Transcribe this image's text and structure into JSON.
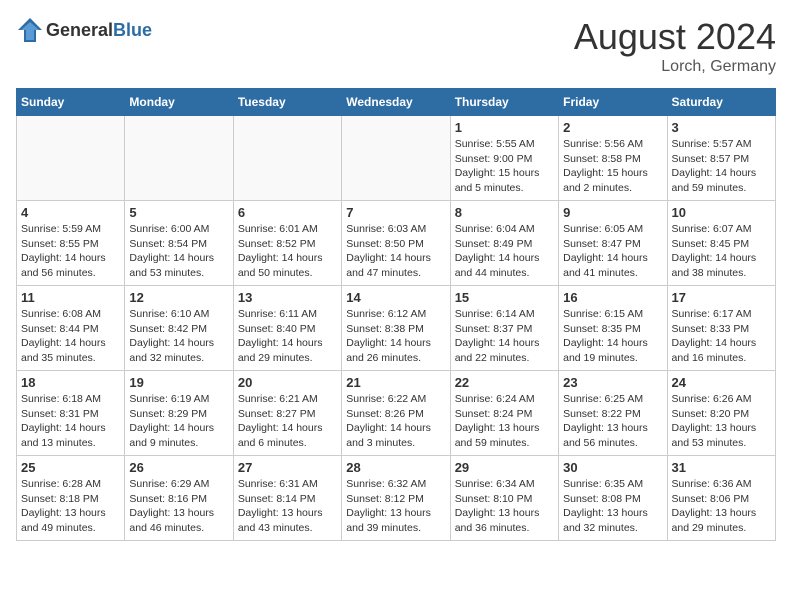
{
  "header": {
    "logo_general": "General",
    "logo_blue": "Blue",
    "month_title": "August 2024",
    "location": "Lorch, Germany"
  },
  "weekdays": [
    "Sunday",
    "Monday",
    "Tuesday",
    "Wednesday",
    "Thursday",
    "Friday",
    "Saturday"
  ],
  "weeks": [
    [
      {
        "day": "",
        "info": ""
      },
      {
        "day": "",
        "info": ""
      },
      {
        "day": "",
        "info": ""
      },
      {
        "day": "",
        "info": ""
      },
      {
        "day": "1",
        "info": "Sunrise: 5:55 AM\nSunset: 9:00 PM\nDaylight: 15 hours\nand 5 minutes."
      },
      {
        "day": "2",
        "info": "Sunrise: 5:56 AM\nSunset: 8:58 PM\nDaylight: 15 hours\nand 2 minutes."
      },
      {
        "day": "3",
        "info": "Sunrise: 5:57 AM\nSunset: 8:57 PM\nDaylight: 14 hours\nand 59 minutes."
      }
    ],
    [
      {
        "day": "4",
        "info": "Sunrise: 5:59 AM\nSunset: 8:55 PM\nDaylight: 14 hours\nand 56 minutes."
      },
      {
        "day": "5",
        "info": "Sunrise: 6:00 AM\nSunset: 8:54 PM\nDaylight: 14 hours\nand 53 minutes."
      },
      {
        "day": "6",
        "info": "Sunrise: 6:01 AM\nSunset: 8:52 PM\nDaylight: 14 hours\nand 50 minutes."
      },
      {
        "day": "7",
        "info": "Sunrise: 6:03 AM\nSunset: 8:50 PM\nDaylight: 14 hours\nand 47 minutes."
      },
      {
        "day": "8",
        "info": "Sunrise: 6:04 AM\nSunset: 8:49 PM\nDaylight: 14 hours\nand 44 minutes."
      },
      {
        "day": "9",
        "info": "Sunrise: 6:05 AM\nSunset: 8:47 PM\nDaylight: 14 hours\nand 41 minutes."
      },
      {
        "day": "10",
        "info": "Sunrise: 6:07 AM\nSunset: 8:45 PM\nDaylight: 14 hours\nand 38 minutes."
      }
    ],
    [
      {
        "day": "11",
        "info": "Sunrise: 6:08 AM\nSunset: 8:44 PM\nDaylight: 14 hours\nand 35 minutes."
      },
      {
        "day": "12",
        "info": "Sunrise: 6:10 AM\nSunset: 8:42 PM\nDaylight: 14 hours\nand 32 minutes."
      },
      {
        "day": "13",
        "info": "Sunrise: 6:11 AM\nSunset: 8:40 PM\nDaylight: 14 hours\nand 29 minutes."
      },
      {
        "day": "14",
        "info": "Sunrise: 6:12 AM\nSunset: 8:38 PM\nDaylight: 14 hours\nand 26 minutes."
      },
      {
        "day": "15",
        "info": "Sunrise: 6:14 AM\nSunset: 8:37 PM\nDaylight: 14 hours\nand 22 minutes."
      },
      {
        "day": "16",
        "info": "Sunrise: 6:15 AM\nSunset: 8:35 PM\nDaylight: 14 hours\nand 19 minutes."
      },
      {
        "day": "17",
        "info": "Sunrise: 6:17 AM\nSunset: 8:33 PM\nDaylight: 14 hours\nand 16 minutes."
      }
    ],
    [
      {
        "day": "18",
        "info": "Sunrise: 6:18 AM\nSunset: 8:31 PM\nDaylight: 14 hours\nand 13 minutes."
      },
      {
        "day": "19",
        "info": "Sunrise: 6:19 AM\nSunset: 8:29 PM\nDaylight: 14 hours\nand 9 minutes."
      },
      {
        "day": "20",
        "info": "Sunrise: 6:21 AM\nSunset: 8:27 PM\nDaylight: 14 hours\nand 6 minutes."
      },
      {
        "day": "21",
        "info": "Sunrise: 6:22 AM\nSunset: 8:26 PM\nDaylight: 14 hours\nand 3 minutes."
      },
      {
        "day": "22",
        "info": "Sunrise: 6:24 AM\nSunset: 8:24 PM\nDaylight: 13 hours\nand 59 minutes."
      },
      {
        "day": "23",
        "info": "Sunrise: 6:25 AM\nSunset: 8:22 PM\nDaylight: 13 hours\nand 56 minutes."
      },
      {
        "day": "24",
        "info": "Sunrise: 6:26 AM\nSunset: 8:20 PM\nDaylight: 13 hours\nand 53 minutes."
      }
    ],
    [
      {
        "day": "25",
        "info": "Sunrise: 6:28 AM\nSunset: 8:18 PM\nDaylight: 13 hours\nand 49 minutes."
      },
      {
        "day": "26",
        "info": "Sunrise: 6:29 AM\nSunset: 8:16 PM\nDaylight: 13 hours\nand 46 minutes."
      },
      {
        "day": "27",
        "info": "Sunrise: 6:31 AM\nSunset: 8:14 PM\nDaylight: 13 hours\nand 43 minutes."
      },
      {
        "day": "28",
        "info": "Sunrise: 6:32 AM\nSunset: 8:12 PM\nDaylight: 13 hours\nand 39 minutes."
      },
      {
        "day": "29",
        "info": "Sunrise: 6:34 AM\nSunset: 8:10 PM\nDaylight: 13 hours\nand 36 minutes."
      },
      {
        "day": "30",
        "info": "Sunrise: 6:35 AM\nSunset: 8:08 PM\nDaylight: 13 hours\nand 32 minutes."
      },
      {
        "day": "31",
        "info": "Sunrise: 6:36 AM\nSunset: 8:06 PM\nDaylight: 13 hours\nand 29 minutes."
      }
    ]
  ]
}
